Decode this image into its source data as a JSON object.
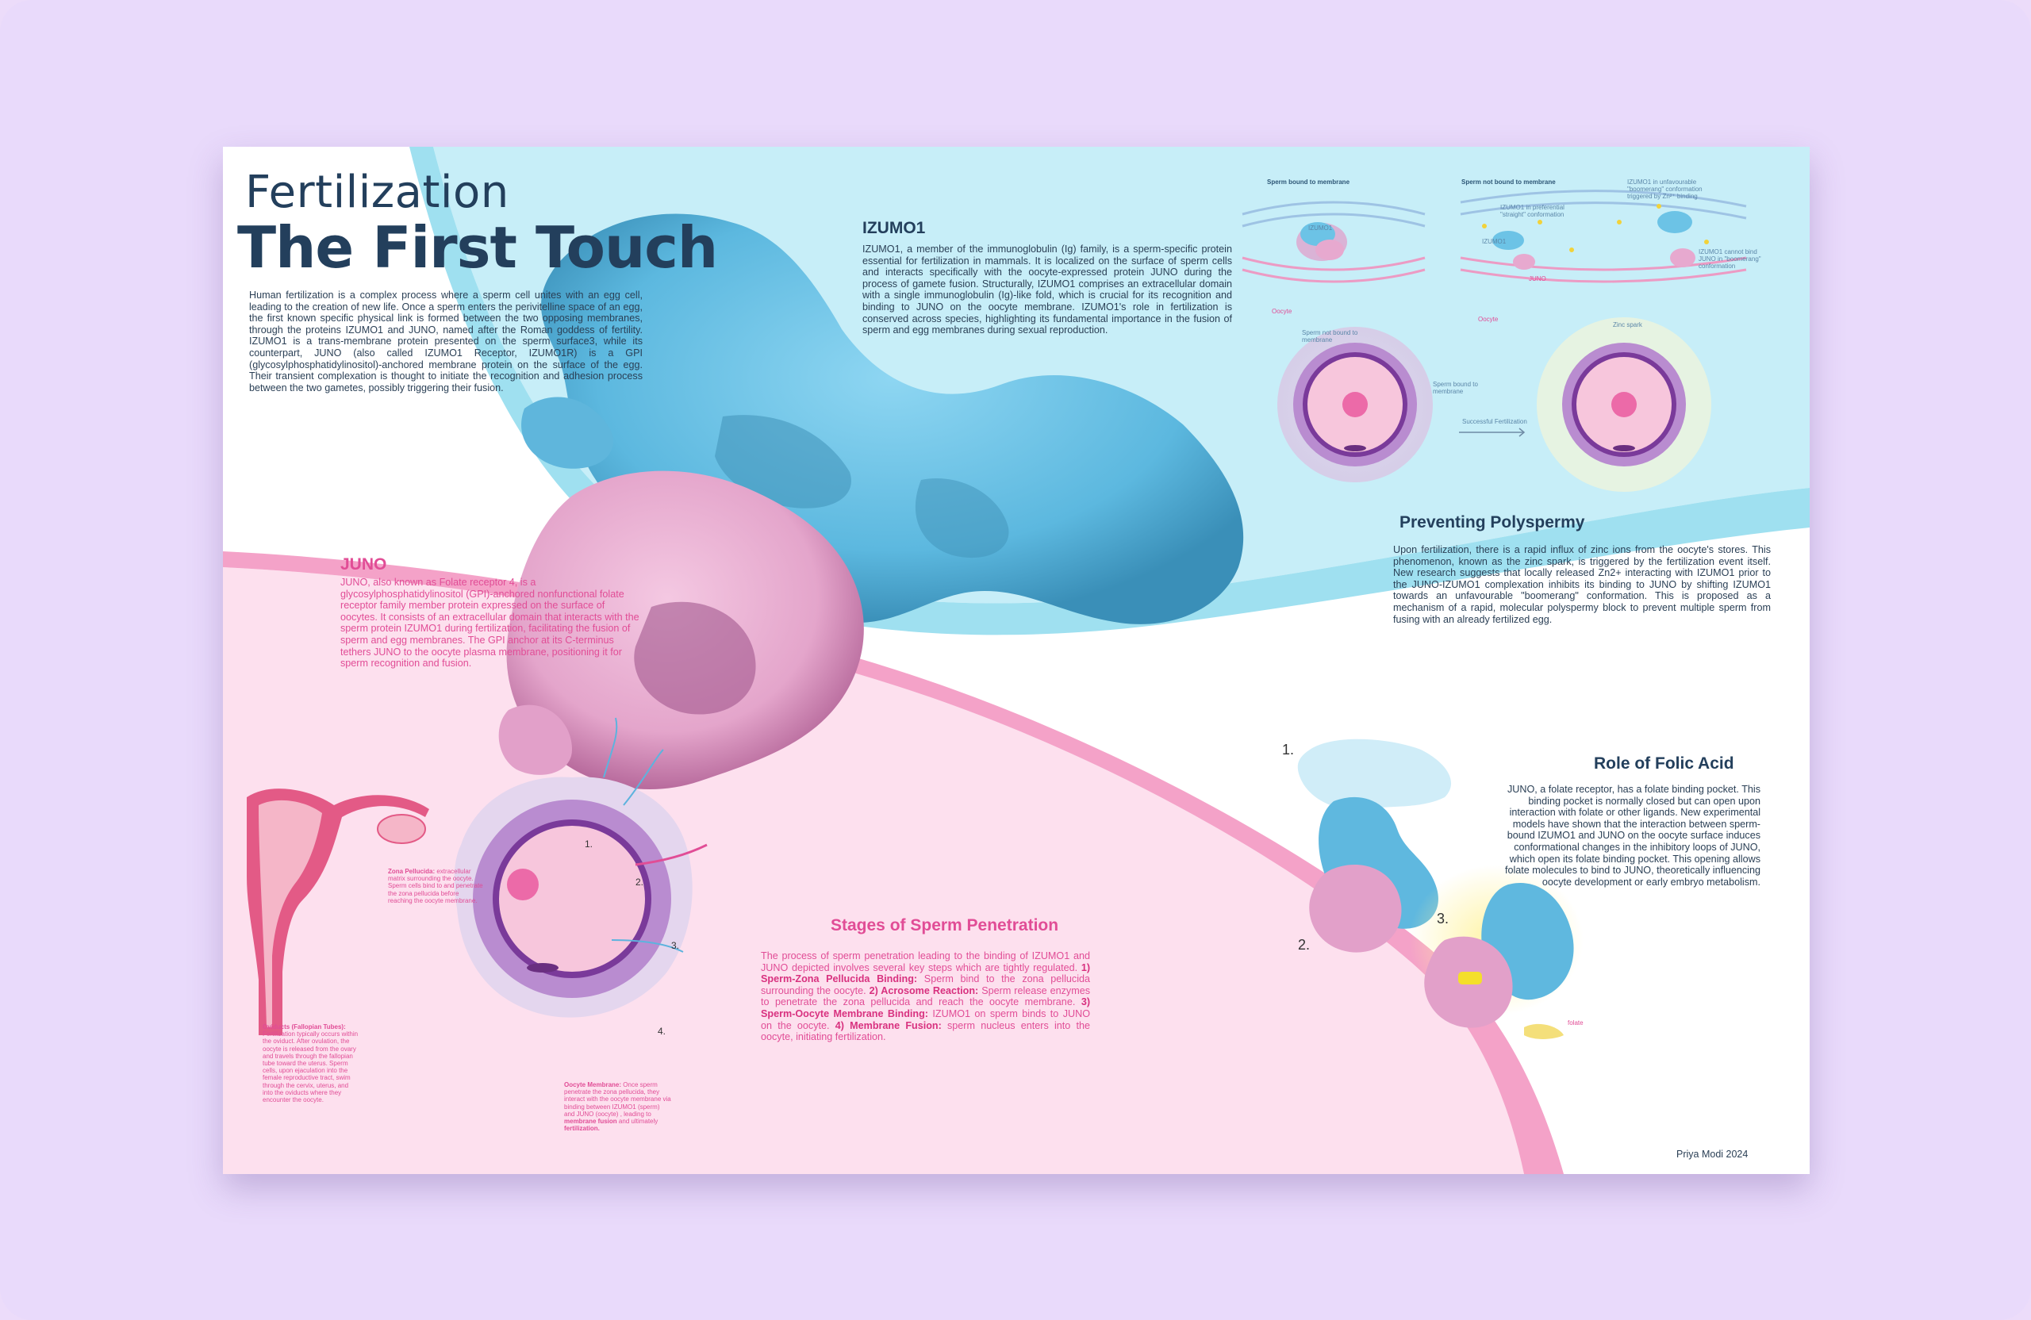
{
  "title": {
    "line1": "Fertilization",
    "line2": "The First Touch"
  },
  "intro": {
    "text": "Human fertilization is a complex process where a sperm cell unites with an egg cell, leading to the creation of new life. Once a sperm enters the perivitelline space of an egg, the first known specific physical link is formed between the two opposing membranes, through the proteins IZUMO1 and JUNO, named after the Roman goddess of fertility. IZUMO1 is a trans-membrane protein presented on the sperm surface3, while its counterpart, JUNO (also called IZUMO1 Receptor, IZUMO1R) is a GPI (glycosylphosphatidylinositol)-anchored membrane protein on the surface of the egg. Their transient complexation is thought to initiate the recognition and adhesion process between the two gametes, possibly triggering their fusion."
  },
  "izumo1": {
    "heading": "IZUMO1",
    "text": "IZUMO1, a member of the immunoglobulin (Ig) family, is a sperm-specific protein essential for fertilization in mammals. It is localized on the surface of sperm cells and interacts specifically with the oocyte-expressed protein JUNO during the process of gamete fusion. Structurally, IZUMO1 comprises an extracellular domain with a single immunoglobulin (Ig)-like fold, which is crucial for its recognition and binding to JUNO on the oocyte membrane. IZUMO1's role in fertilization is conserved across species, highlighting its fundamental importance in the fusion of sperm and egg membranes during sexual reproduction."
  },
  "juno": {
    "heading": "JUNO",
    "text": "JUNO, also known as Folate receptor 4, is a glycosylphosphatidylinositol (GPI)-anchored nonfunctional folate receptor family member protein expressed on the surface of oocytes. It consists of an extracellular domain that interacts with the sperm protein IZUMO1 during fertilization, facilitating the fusion of sperm and egg membranes. The GPI anchor at its C-terminus tethers JUNO to the oocyte plasma membrane, positioning it for sperm recognition and fusion."
  },
  "polyspermy": {
    "heading": "Preventing Polyspermy",
    "text": "Upon fertilization, there is a rapid influx of zinc ions from the oocyte's stores. This phenomenon, known as the zinc spark, is triggered by the fertilization event itself. New research suggests that locally released Zn2+ interacting with IZUMO1 prior to the JUNO-IZUMO1 complexation inhibits its binding to JUNO by shifting IZUMO1 towards an unfavourable \"boomerang\" conformation. This is proposed as a mechanism of a rapid, molecular polyspermy block to prevent multiple sperm from fusing with an already fertilized egg."
  },
  "folic": {
    "heading": "Role of Folic Acid",
    "text": "JUNO, a folate receptor, has a folate binding pocket. This binding pocket is normally closed but can open upon interaction with folate or other ligands. New experimental models have shown that the interaction between sperm-bound IZUMO1 and JUNO on the oocyte surface induces conformational changes in the inhibitory loops of JUNO, which open its folate binding pocket. This opening allows folate molecules to bind to JUNO, theoretically influencing oocyte development or early embryo metabolism.",
    "step1": "1.",
    "step2": "2.",
    "step3": "3.",
    "folate_label": "folate"
  },
  "stages": {
    "heading": "Stages of Sperm Penetration",
    "intro": "The process of sperm penetration leading to the binding of IZUMO1 and JUNO depicted involves several key steps which are tightly regulated.",
    "s1_title": "1) Sperm-Zona Pellucida Binding:",
    "s1_text": "Sperm bind to the zona pellucida surrounding the oocyte.",
    "s2_title": "2) Acrosome Reaction:",
    "s2_text": "Sperm release enzymes to penetrate the zona pellucida and reach the oocyte membrane.",
    "s3_title": "3) Sperm-Oocyte Membrane Binding:",
    "s3_text": "IZUMO1 on sperm binds to JUNO on the oocyte.",
    "s4_title": "4) Membrane Fusion:",
    "s4_text": "sperm nucleus enters into the oocyte, initiating fertilization."
  },
  "egg_diagram": {
    "n1": "1.",
    "n2": "2.",
    "n3": "3.",
    "n4": "4.",
    "zona_title": "Zona Pellucida:",
    "zona_text": "extracellular matrix surrounding the oocyte. Sperm cells bind to and penetrate the zona pellucida before reaching the oocyte membrane.",
    "oviduct_title": "Oviducts (Fallopian Tubes):",
    "oviduct_text": "Fertilization typically occurs within the oviduct. After ovulation, the oocyte is released from the ovary and travels through the fallopian tube toward the uterus. Sperm cells, upon ejaculation into the female reproductive tract, swim through the cervix, uterus, and into the oviducts where they encounter the oocyte.",
    "membrane_title": "Oocyte Membrane:",
    "membrane_text": "Once sperm penetrate the zona pellucida, they interact with the oocyte membrane via binding between IZUMO1 (sperm) and JUNO (oocyte) , leading to",
    "membrane_bold1": "membrane fusion",
    "membrane_and": "and ultimately",
    "membrane_bold2": "fertilization."
  },
  "zinc_diagram": {
    "bound_label": "Sperm bound to membrane",
    "notbound_label": "Sperm not bound to membrane",
    "izumo_label": "IZUMO1",
    "juno_label": "JUNO",
    "oocyte_label": "Oocyte",
    "straight_label": "IZUMO1 in preferential \"straight\" conformation",
    "boomerang_label": "IZUMO1 in unfavourable \"boomerang\" conformation triggered by Zn²⁺ binding",
    "cannot_label": "IZUMO1 cannot bind JUNO in \"boomerang\" conformation",
    "egg_notbound": "Sperm not bound to membrane",
    "egg_bound": "Sperm bound to membrane",
    "success": "Successful Fertilization",
    "zinc_spark": "Zinc spark"
  },
  "credit": "Priya Modi 2024",
  "colors": {
    "blue_protein": "#6cc3e6",
    "pink_protein": "#e7a9cf",
    "accent_pink": "#e14d96",
    "title_navy": "#233f5c"
  }
}
